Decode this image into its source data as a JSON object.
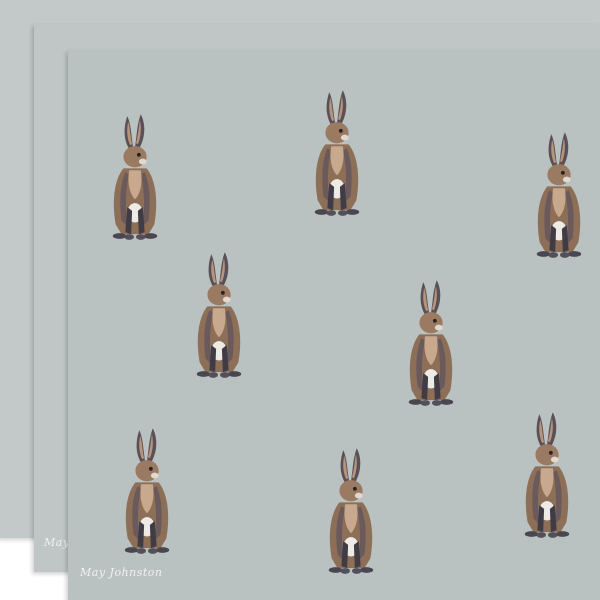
{
  "colors": {
    "sheet_back": "#c3c9c8",
    "sheet_mid": "#bfc6c5",
    "sheet_front": "#bac2c1",
    "hare_fur": "#9a7a60",
    "hare_dark": "#4a4650",
    "hare_light": "#e9e6e2",
    "hare_shadow": "#6a6470"
  },
  "signature": {
    "text": "May Johnston"
  },
  "illustration": {
    "subject": "hare-pattern",
    "hare_count_front_sheet": 8
  }
}
